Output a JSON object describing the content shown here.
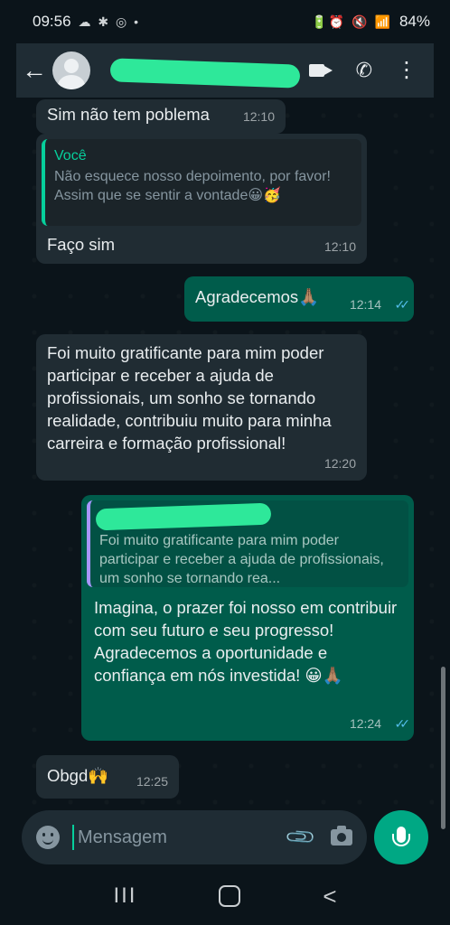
{
  "status_bar": {
    "time": "09:56",
    "left_icons": "☁ ✱ ◎ •",
    "right_icons": "🔋⏰ 🔇 📶",
    "battery": "84%"
  },
  "header": {
    "back": "←",
    "kebab": "⋮"
  },
  "colors": {
    "incoming": "#202c33",
    "outgoing": "#005c4b",
    "accent": "#00a884",
    "read_ticks": "#53bdeb",
    "redaction": "#2ee89a"
  },
  "messages": [
    {
      "dir": "in",
      "text": "Sim não tem poblema",
      "time": "12:10"
    },
    {
      "dir": "in",
      "quote_author": "Você",
      "quote_text": "Não esquece nosso depoimento, por favor!\nAssim que se sentir a vontade😀🥳",
      "text": "Faço sim",
      "time": "12:10"
    },
    {
      "dir": "out",
      "text": "Agradecemos🙏🏽",
      "time": "12:14",
      "status": "read"
    },
    {
      "dir": "in",
      "text": "Foi muito gratificante para mim poder participar e receber a ajuda de profissionais, um sonho se tornando realidade, contribuiu muito para minha carreira e formação profissional!",
      "time": "12:20"
    },
    {
      "dir": "out",
      "quote_text": "Foi muito gratificante para mim poder participar e receber a ajuda de profissionais, um sonho se tornando rea...",
      "text": "Imagina, o prazer foi nosso em contribuir com seu futuro e seu progresso!\nAgradecemos a oportunidade e confiança em nós investida! 😀🙏🏽",
      "time": "12:24",
      "status": "read"
    },
    {
      "dir": "in",
      "text": "Obgd🙌",
      "time": "12:25"
    }
  ],
  "input": {
    "placeholder": "Mensagem"
  },
  "nav": {
    "recent": "III",
    "back": "<"
  }
}
